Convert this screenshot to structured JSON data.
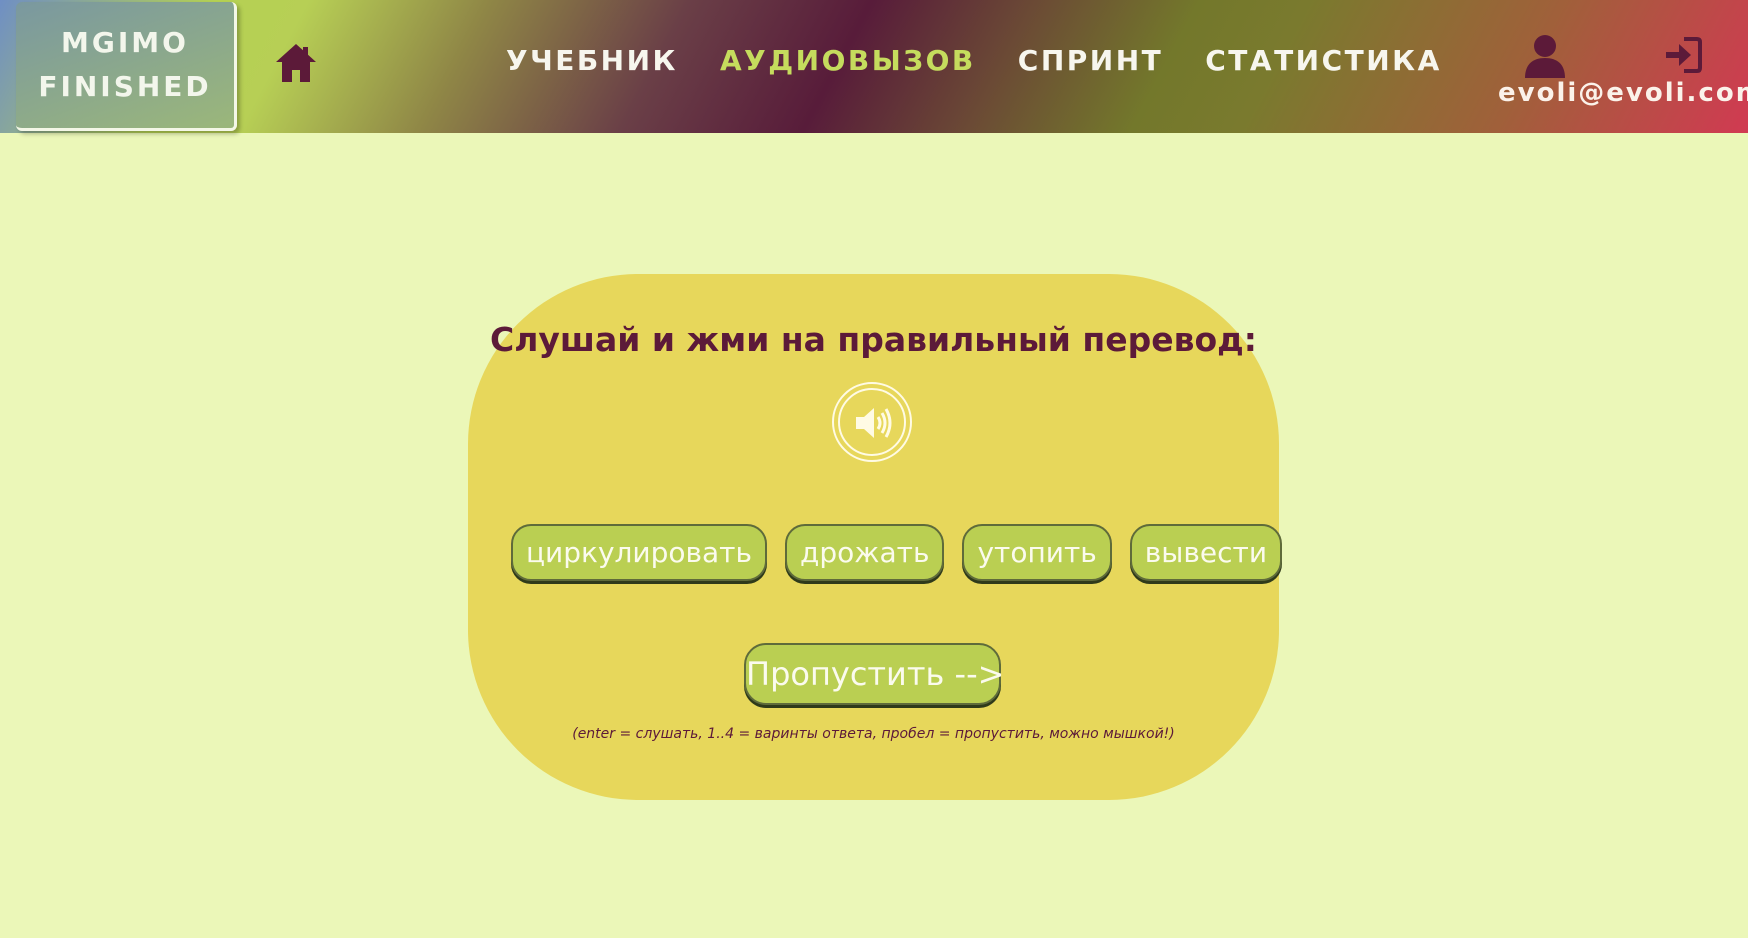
{
  "header": {
    "logo_line1": "MGIMO",
    "logo_line2": "FINISHED",
    "home_icon": "home-icon",
    "nav": [
      {
        "label": "УЧЕБНИК",
        "active": false
      },
      {
        "label": "АУДИОВЫЗОВ",
        "active": true
      },
      {
        "label": "СПРИНТ",
        "active": false
      },
      {
        "label": "СТАТИСТИКА",
        "active": false
      }
    ],
    "user_icon": "user-icon",
    "logout_icon": "logout-icon",
    "email": "evoli@evoli.com"
  },
  "game": {
    "prompt": "Слушай и жми на правильный перевод:",
    "audio_icon": "speaker-icon",
    "answers": [
      "циркулировать",
      "дрожать",
      "утопить",
      "вывести"
    ],
    "skip_label": "Пропустить -->",
    "hint": "(enter = слушать, 1..4 = варинты ответа, пробел = пропустить, можно мышкой!)"
  },
  "colors": {
    "page_background": "#ebf7b8",
    "card_background": "#e7d75b",
    "button_background": "#bacf52",
    "accent_dark": "#5c1a39",
    "nav_active": "#c5dc5d"
  }
}
